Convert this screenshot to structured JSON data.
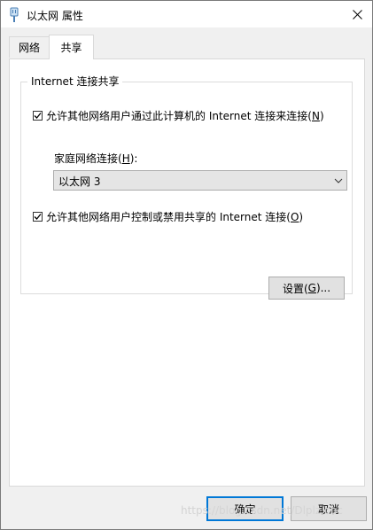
{
  "window": {
    "title": "以太网 属性",
    "icon": "network-adapter-icon"
  },
  "tabs": [
    {
      "label": "网络",
      "active": false
    },
    {
      "label": "共享",
      "active": true
    }
  ],
  "group": {
    "legend": "Internet 连接共享",
    "allow_share": {
      "checked": true,
      "label_before": "允许其他网络用户通过此计算机的 Internet 连接来连接(",
      "access_key": "N",
      "label_after": ")"
    },
    "home_network": {
      "label_before": "家庭网络连接(",
      "access_key": "H",
      "label_after": "):",
      "selected": "以太网 3"
    },
    "allow_control": {
      "checked": true,
      "label_before": "允许其他网络用户控制或禁用共享的 Internet 连接(",
      "access_key": "O",
      "label_after": ")"
    },
    "settings_button": {
      "label_before": "设置(",
      "access_key": "G",
      "label_after": ")..."
    }
  },
  "footer": {
    "ok_label": "确定",
    "cancel_label": "取消"
  },
  "watermark": "https://blog.csdn.net/Dlplz.cbc"
}
